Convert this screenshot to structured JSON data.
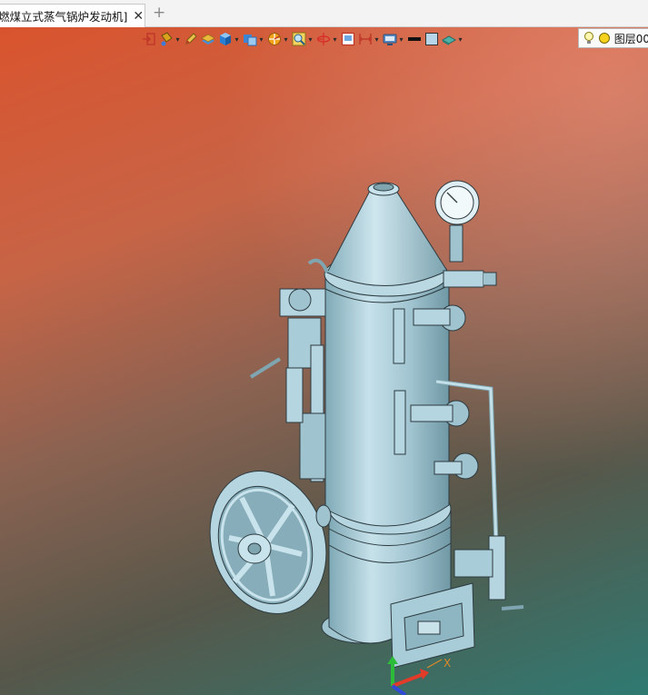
{
  "tab": {
    "title": "燃煤立式蒸气锅炉发动机]",
    "close_glyph": "✕",
    "add_glyph": "+"
  },
  "toolbar": {
    "items": [
      {
        "icon": "exit-sketch-icon",
        "dropdown": false
      },
      {
        "icon": "paint-bucket-icon",
        "dropdown": true
      },
      {
        "icon": "pencil-icon",
        "dropdown": false
      },
      {
        "icon": "layer-stack-icon",
        "dropdown": false
      },
      {
        "icon": "cube-icon",
        "dropdown": true
      },
      {
        "icon": "view-cube-icon",
        "dropdown": true
      },
      {
        "icon": "section-view-icon",
        "dropdown": true
      },
      {
        "icon": "zoom-fit-icon",
        "dropdown": true
      },
      {
        "icon": "rotate-axis-icon",
        "dropdown": true
      },
      {
        "icon": "screenshot-icon",
        "dropdown": false
      },
      {
        "icon": "measure-icon",
        "dropdown": true
      },
      {
        "icon": "display-mode-icon",
        "dropdown": true
      },
      {
        "icon": "line-weight-icon",
        "dropdown": false
      },
      {
        "icon": "color-swatch-icon",
        "dropdown": false
      },
      {
        "icon": "plane-icon",
        "dropdown": true
      }
    ],
    "layer_selector": {
      "label": "图层00"
    }
  },
  "colors": {
    "model_fill": "#a9cdd8",
    "model_edge": "#2d3b40",
    "axis_x": "#e23b2a",
    "axis_y": "#2dbb3a",
    "axis_z": "#2f49d8",
    "axis_label": "#d88a2a"
  },
  "axis": {
    "x_label": "X"
  }
}
